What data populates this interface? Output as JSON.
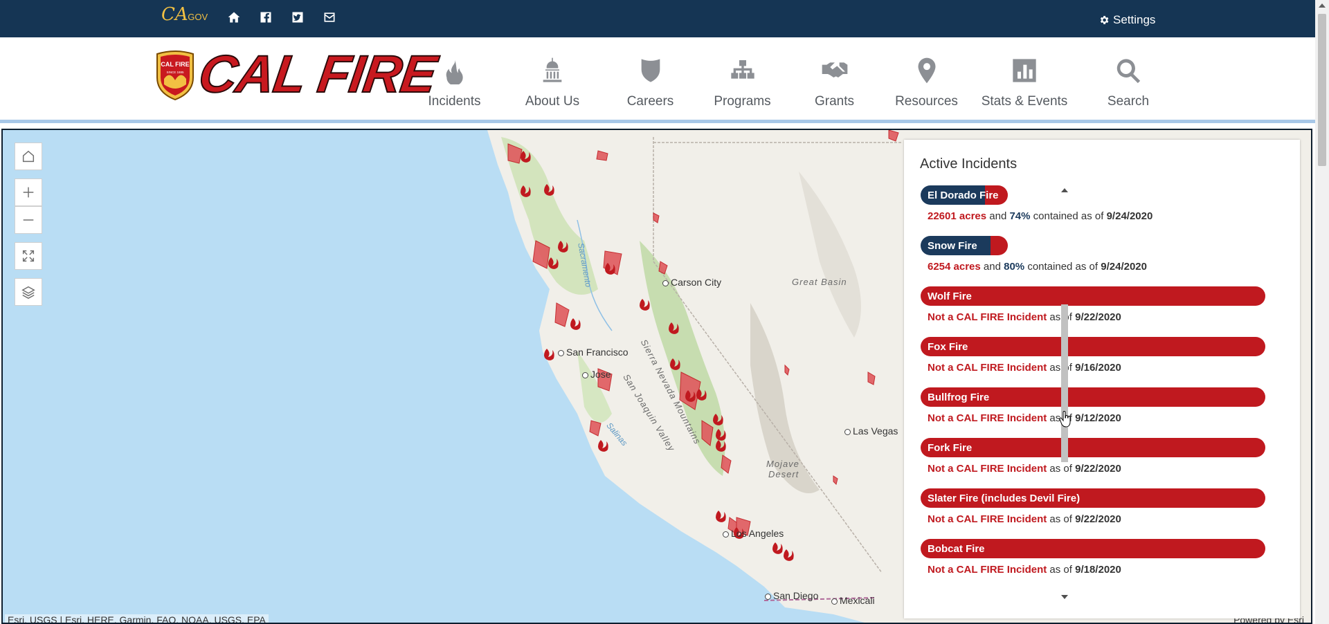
{
  "utility": {
    "ca_gov_main": "CA",
    "ca_gov_suffix": ".GOV",
    "settings_label": "Settings"
  },
  "brand": {
    "logo_text": "CAL FIRE",
    "badge_text": "CAL FIRE",
    "badge_since": "SINCE 1885",
    "color_red": "#c8191f",
    "color_navy": "#153554"
  },
  "nav": {
    "items": [
      {
        "label": "Incidents",
        "icon": "flame-icon"
      },
      {
        "label": "About Us",
        "icon": "capitol-icon"
      },
      {
        "label": "Careers",
        "icon": "shield-icon"
      },
      {
        "label": "Programs",
        "icon": "org-chart-icon"
      },
      {
        "label": "Grants",
        "icon": "handshake-icon"
      },
      {
        "label": "Resources",
        "icon": "map-pin-icon"
      },
      {
        "label": "Stats & Events",
        "icon": "bar-chart-icon"
      },
      {
        "label": "Search",
        "icon": "search-icon"
      }
    ]
  },
  "map": {
    "cities": {
      "carson_city": "Carson City",
      "san_francisco": "San Francisco",
      "san_jose": "Jose",
      "las_vegas": "Las Vegas",
      "los_angeles": "Los Angeles",
      "san_diego": "San Diego",
      "mexicali": "Mexicali"
    },
    "regions": {
      "great_basin": "Great Basin",
      "sierra_nevada": "Sierra Nevada Mountains",
      "san_joaquin": "San Joaquin Valley",
      "mojave_1": "Mojave",
      "mojave_2": "Desert"
    },
    "water": {
      "sacramento": "Sacramento",
      "salinas": "Salinas"
    },
    "attribution": "Esri, USGS | Esri, HERE, Garmin, FAO, NOAA, USGS, EPA",
    "powered_by": "Powered by Esri"
  },
  "panel": {
    "title": "Active Incidents",
    "connector_and": "and",
    "contained_as_of": "contained as of",
    "as_of": "as of",
    "not_cal_fire": "Not a CAL FIRE Incident",
    "incidents": [
      {
        "name": "El Dorado Fire",
        "acres": "22601 acres",
        "contained": "74%",
        "contained_pct": 74,
        "date": "9/24/2020"
      },
      {
        "name": "Snow Fire",
        "acres": "6254 acres",
        "contained": "80%",
        "contained_pct": 80,
        "date": "9/24/2020"
      },
      {
        "name": "Wolf Fire",
        "date": "9/22/2020"
      },
      {
        "name": "Fox Fire",
        "date": "9/16/2020"
      },
      {
        "name": "Bullfrog Fire",
        "date": "9/12/2020"
      },
      {
        "name": "Fork Fire",
        "date": "9/22/2020"
      },
      {
        "name": "Slater Fire (includes Devil Fire)",
        "date": "9/22/2020"
      },
      {
        "name": "Bobcat Fire",
        "date": "9/18/2020"
      }
    ]
  }
}
